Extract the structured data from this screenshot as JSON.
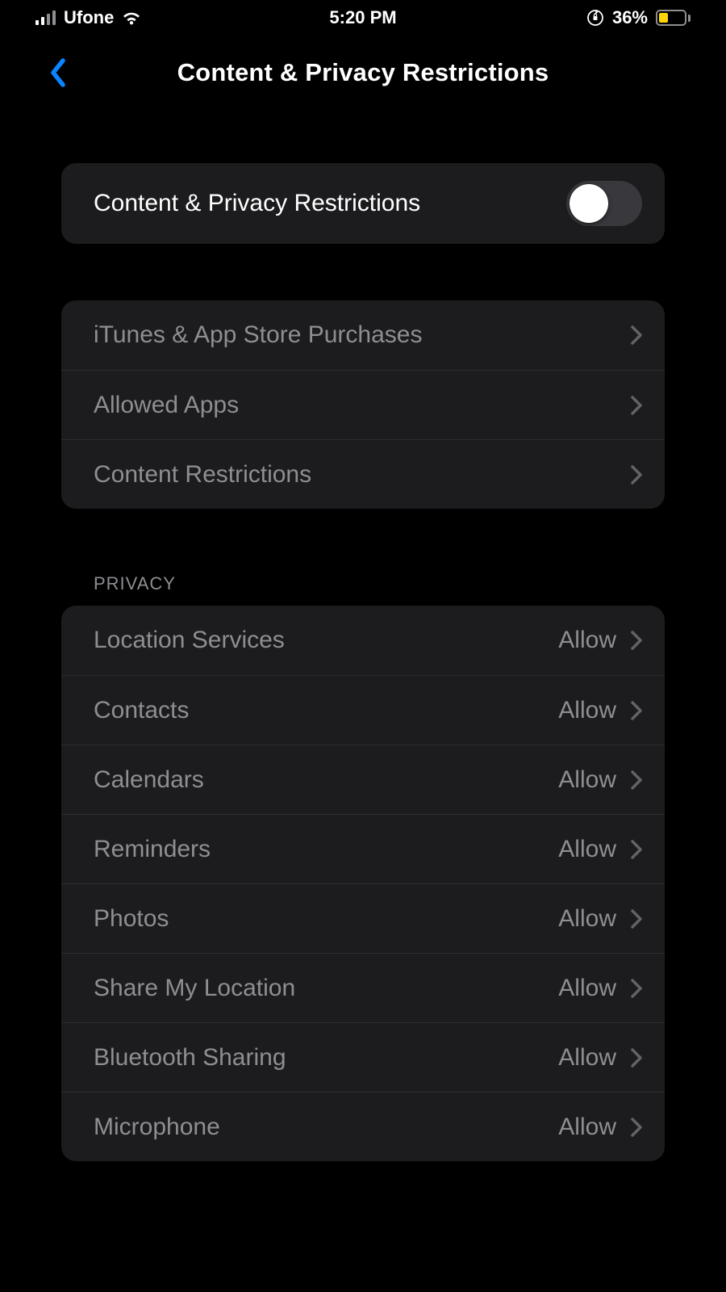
{
  "status": {
    "carrier": "Ufone",
    "time": "5:20 PM",
    "battery_percent": "36%"
  },
  "nav": {
    "title": "Content & Privacy Restrictions"
  },
  "toggle_row": {
    "label": "Content & Privacy Restrictions",
    "enabled": false
  },
  "content_group": [
    {
      "label": "iTunes & App Store Purchases"
    },
    {
      "label": "Allowed Apps"
    },
    {
      "label": "Content Restrictions"
    }
  ],
  "privacy_header": "PRIVACY",
  "privacy_group": [
    {
      "label": "Location Services",
      "value": "Allow"
    },
    {
      "label": "Contacts",
      "value": "Allow"
    },
    {
      "label": "Calendars",
      "value": "Allow"
    },
    {
      "label": "Reminders",
      "value": "Allow"
    },
    {
      "label": "Photos",
      "value": "Allow"
    },
    {
      "label": "Share My Location",
      "value": "Allow"
    },
    {
      "label": "Bluetooth Sharing",
      "value": "Allow"
    },
    {
      "label": "Microphone",
      "value": "Allow"
    }
  ]
}
